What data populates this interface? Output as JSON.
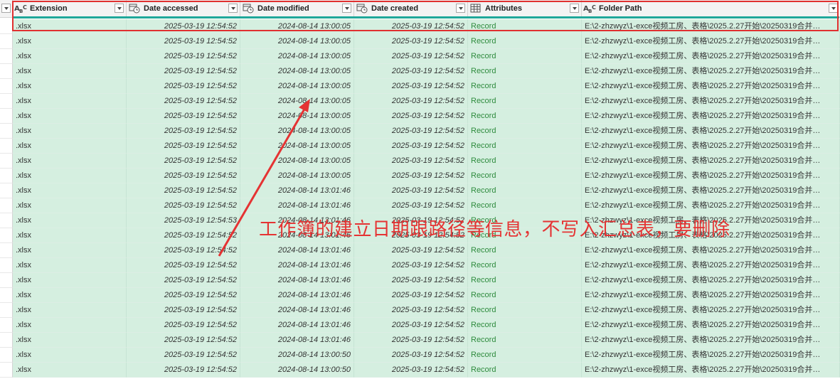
{
  "columns": [
    {
      "key": "ext",
      "label": "Extension",
      "type": "text"
    },
    {
      "key": "acc",
      "label": "Date accessed",
      "type": "datetime"
    },
    {
      "key": "mod",
      "label": "Date modified",
      "type": "datetime"
    },
    {
      "key": "cre",
      "label": "Date created",
      "type": "datetime"
    },
    {
      "key": "attr",
      "label": "Attributes",
      "type": "record"
    },
    {
      "key": "path",
      "label": "Folder Path",
      "type": "text"
    }
  ],
  "type_icons": {
    "text": "abc-type-icon",
    "datetime": "datetime-type-icon",
    "record": "table-type-icon"
  },
  "colors": {
    "accent": "#1fa89a",
    "highlight": "#e03030",
    "row_bg": "#d5efe0",
    "record": "#2e8b3d",
    "annotation": "#e53333"
  },
  "rows": [
    {
      "ext": ".xlsx",
      "acc": "2025-03-19 12:54:52",
      "mod": "2024-08-14 13:00:05",
      "cre": "2025-03-19 12:54:52",
      "attr": "Record",
      "path": "E:\\2-zhzwyz\\1-exce视频工房、表格\\2025.2.27开始\\20250319合并…"
    },
    {
      "ext": ".xlsx",
      "acc": "2025-03-19 12:54:52",
      "mod": "2024-08-14 13:00:05",
      "cre": "2025-03-19 12:54:52",
      "attr": "Record",
      "path": "E:\\2-zhzwyz\\1-exce视频工房、表格\\2025.2.27开始\\20250319合并…"
    },
    {
      "ext": ".xlsx",
      "acc": "2025-03-19 12:54:52",
      "mod": "2024-08-14 13:00:05",
      "cre": "2025-03-19 12:54:52",
      "attr": "Record",
      "path": "E:\\2-zhzwyz\\1-exce视频工房、表格\\2025.2.27开始\\20250319合并…"
    },
    {
      "ext": ".xlsx",
      "acc": "2025-03-19 12:54:52",
      "mod": "2024-08-14 13:00:05",
      "cre": "2025-03-19 12:54:52",
      "attr": "Record",
      "path": "E:\\2-zhzwyz\\1-exce视频工房、表格\\2025.2.27开始\\20250319合并…"
    },
    {
      "ext": ".xlsx",
      "acc": "2025-03-19 12:54:52",
      "mod": "2024-08-14 13:00:05",
      "cre": "2025-03-19 12:54:52",
      "attr": "Record",
      "path": "E:\\2-zhzwyz\\1-exce视频工房、表格\\2025.2.27开始\\20250319合并…"
    },
    {
      "ext": ".xlsx",
      "acc": "2025-03-19 12:54:52",
      "mod": "2024-08-14 13:00:05",
      "cre": "2025-03-19 12:54:52",
      "attr": "Record",
      "path": "E:\\2-zhzwyz\\1-exce视频工房、表格\\2025.2.27开始\\20250319合并…"
    },
    {
      "ext": ".xlsx",
      "acc": "2025-03-19 12:54:52",
      "mod": "2024-08-14 13:00:05",
      "cre": "2025-03-19 12:54:52",
      "attr": "Record",
      "path": "E:\\2-zhzwyz\\1-exce视频工房、表格\\2025.2.27开始\\20250319合并…"
    },
    {
      "ext": ".xlsx",
      "acc": "2025-03-19 12:54:52",
      "mod": "2024-08-14 13:00:05",
      "cre": "2025-03-19 12:54:52",
      "attr": "Record",
      "path": "E:\\2-zhzwyz\\1-exce视频工房、表格\\2025.2.27开始\\20250319合并…"
    },
    {
      "ext": ".xlsx",
      "acc": "2025-03-19 12:54:52",
      "mod": "2024-08-14 13:00:05",
      "cre": "2025-03-19 12:54:52",
      "attr": "Record",
      "path": "E:\\2-zhzwyz\\1-exce视频工房、表格\\2025.2.27开始\\20250319合并…"
    },
    {
      "ext": ".xlsx",
      "acc": "2025-03-19 12:54:52",
      "mod": "2024-08-14 13:00:05",
      "cre": "2025-03-19 12:54:52",
      "attr": "Record",
      "path": "E:\\2-zhzwyz\\1-exce视频工房、表格\\2025.2.27开始\\20250319合并…"
    },
    {
      "ext": ".xlsx",
      "acc": "2025-03-19 12:54:52",
      "mod": "2024-08-14 13:00:05",
      "cre": "2025-03-19 12:54:52",
      "attr": "Record",
      "path": "E:\\2-zhzwyz\\1-exce视频工房、表格\\2025.2.27开始\\20250319合并…"
    },
    {
      "ext": ".xlsx",
      "acc": "2025-03-19 12:54:52",
      "mod": "2024-08-14 13:01:46",
      "cre": "2025-03-19 12:54:52",
      "attr": "Record",
      "path": "E:\\2-zhzwyz\\1-exce视频工房、表格\\2025.2.27开始\\20250319合并…"
    },
    {
      "ext": ".xlsx",
      "acc": "2025-03-19 12:54:52",
      "mod": "2024-08-14 13:01:46",
      "cre": "2025-03-19 12:54:52",
      "attr": "Record",
      "path": "E:\\2-zhzwyz\\1-exce视频工房、表格\\2025.2.27开始\\20250319合并…"
    },
    {
      "ext": ".xlsx",
      "acc": "2025-03-19 12:54:53",
      "mod": "2024-08-14 13:01:46",
      "cre": "2025-03-19 12:54:52",
      "attr": "Record",
      "path": "E:\\2-zhzwyz\\1-exce视频工房、表格\\2025.2.27开始\\20250319合并…"
    },
    {
      "ext": ".xlsx",
      "acc": "2025-03-19 12:54:52",
      "mod": "2024-08-14 13:01:46",
      "cre": "2025-03-19 12:54:52",
      "attr": "Record",
      "path": "E:\\2-zhzwyz\\1-exce视频工房、表格\\2025.2.27开始\\20250319合并…"
    },
    {
      "ext": ".xlsx",
      "acc": "2025-03-19 12:54:52",
      "mod": "2024-08-14 13:01:46",
      "cre": "2025-03-19 12:54:52",
      "attr": "Record",
      "path": "E:\\2-zhzwyz\\1-exce视频工房、表格\\2025.2.27开始\\20250319合并…"
    },
    {
      "ext": ".xlsx",
      "acc": "2025-03-19 12:54:52",
      "mod": "2024-08-14 13:01:46",
      "cre": "2025-03-19 12:54:52",
      "attr": "Record",
      "path": "E:\\2-zhzwyz\\1-exce视频工房、表格\\2025.2.27开始\\20250319合并…"
    },
    {
      "ext": ".xlsx",
      "acc": "2025-03-19 12:54:52",
      "mod": "2024-08-14 13:01:46",
      "cre": "2025-03-19 12:54:52",
      "attr": "Record",
      "path": "E:\\2-zhzwyz\\1-exce视频工房、表格\\2025.2.27开始\\20250319合并…"
    },
    {
      "ext": ".xlsx",
      "acc": "2025-03-19 12:54:52",
      "mod": "2024-08-14 13:01:46",
      "cre": "2025-03-19 12:54:52",
      "attr": "Record",
      "path": "E:\\2-zhzwyz\\1-exce视频工房、表格\\2025.2.27开始\\20250319合并…"
    },
    {
      "ext": ".xlsx",
      "acc": "2025-03-19 12:54:52",
      "mod": "2024-08-14 13:01:46",
      "cre": "2025-03-19 12:54:52",
      "attr": "Record",
      "path": "E:\\2-zhzwyz\\1-exce视频工房、表格\\2025.2.27开始\\20250319合并…"
    },
    {
      "ext": ".xlsx",
      "acc": "2025-03-19 12:54:52",
      "mod": "2024-08-14 13:01:46",
      "cre": "2025-03-19 12:54:52",
      "attr": "Record",
      "path": "E:\\2-zhzwyz\\1-exce视频工房、表格\\2025.2.27开始\\20250319合并…"
    },
    {
      "ext": ".xlsx",
      "acc": "2025-03-19 12:54:52",
      "mod": "2024-08-14 13:01:46",
      "cre": "2025-03-19 12:54:52",
      "attr": "Record",
      "path": "E:\\2-zhzwyz\\1-exce视频工房、表格\\2025.2.27开始\\20250319合并…"
    },
    {
      "ext": ".xlsx",
      "acc": "2025-03-19 12:54:52",
      "mod": "2024-08-14 13:00:50",
      "cre": "2025-03-19 12:54:52",
      "attr": "Record",
      "path": "E:\\2-zhzwyz\\1-exce视频工房、表格\\2025.2.27开始\\20250319合并…"
    },
    {
      "ext": ".xlsx",
      "acc": "2025-03-19 12:54:52",
      "mod": "2024-08-14 13:00:50",
      "cre": "2025-03-19 12:54:52",
      "attr": "Record",
      "path": "E:\\2-zhzwyz\\1-exce视频工房、表格\\2025.2.27开始\\20250319合并…"
    }
  ],
  "annotation": {
    "text": "工作簿的建立日期跟路径等信息，不写入汇总表，要删除"
  }
}
